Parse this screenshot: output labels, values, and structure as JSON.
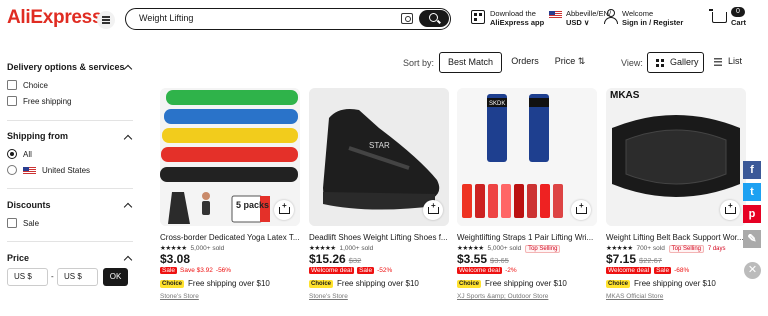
{
  "header": {
    "logo": "AliExpress",
    "search_value": "Weight Lifting",
    "download_line1": "Download the",
    "download_line2": "AliExpress app",
    "region_line1": "Abbeville/EN/",
    "region_line2": "USD ∨",
    "welcome_line1": "Welcome",
    "welcome_line2": "Sign in / Register",
    "cart_count": "0",
    "cart_label": "Cart"
  },
  "sidebar": {
    "delivery": {
      "title": "Delivery options & services",
      "options": [
        "Choice",
        "Free shipping"
      ]
    },
    "ship_from": {
      "title": "Shipping from",
      "options": [
        "All",
        "United States"
      ]
    },
    "discounts": {
      "title": "Discounts",
      "options": [
        "Sale"
      ]
    },
    "price": {
      "title": "Price",
      "min_placeholder": "US $",
      "max_placeholder": "US $",
      "ok_label": "OK",
      "separator": "-"
    }
  },
  "sort": {
    "label": "Sort by:",
    "options": [
      "Best Match",
      "Orders",
      "Price ⇅"
    ],
    "active": "Best Match"
  },
  "view": {
    "label": "View:",
    "options": [
      "Gallery",
      "List"
    ],
    "active": "Gallery"
  },
  "products": [
    {
      "title": "Cross-border Dedicated Yoga Latex T...",
      "stars": "★★★★★",
      "sold": "5,000+ sold",
      "price": "$3.08",
      "old_price": "",
      "tag1": "Sale",
      "tag2": "Save $3.92",
      "tag3": "-56%",
      "choice": "Choice",
      "shipping": "Free shipping over $10",
      "store": "Stone's Store",
      "image_text": "5 packs"
    },
    {
      "title": "Deadlift Shoes Weight Lifting Shoes f...",
      "stars": "★★★★★",
      "sold": "1,000+ sold",
      "price": "$15.26",
      "old_price": "$32",
      "tag1": "Welcome deal",
      "tag2": "Sale",
      "tag3": "-52%",
      "choice": "Choice",
      "shipping": "Free shipping over $10",
      "store": "Stone's Store",
      "image_text": "STAR"
    },
    {
      "title": "Weightlifting Straps 1 Pair Lifting Wri...",
      "stars": "★★★★★",
      "sold": "5,000+ sold",
      "top_badge": "Top Selling",
      "price": "$3.55",
      "old_price": "$3.65",
      "tag1": "Welcome deal",
      "tag2": "-2%",
      "tag3": "",
      "choice": "Choice",
      "shipping": "Free shipping over $10",
      "store": "XJ Sports &amp; Outdoor Store",
      "image_text": "SKDK"
    },
    {
      "title": "Weight Lifting Belt Back Support Wor...",
      "stars": "★★★★★",
      "sold": "700+ sold",
      "top_badge": "Top Selling",
      "days": "7 days",
      "price": "$7.15",
      "old_price": "$22.67",
      "tag1": "Welcome deal",
      "tag2": "Sale",
      "tag3": "-68%",
      "choice": "Choice",
      "shipping": "Free shipping over $10",
      "store": "MKAS Official Store",
      "image_text": "MKAS"
    }
  ]
}
